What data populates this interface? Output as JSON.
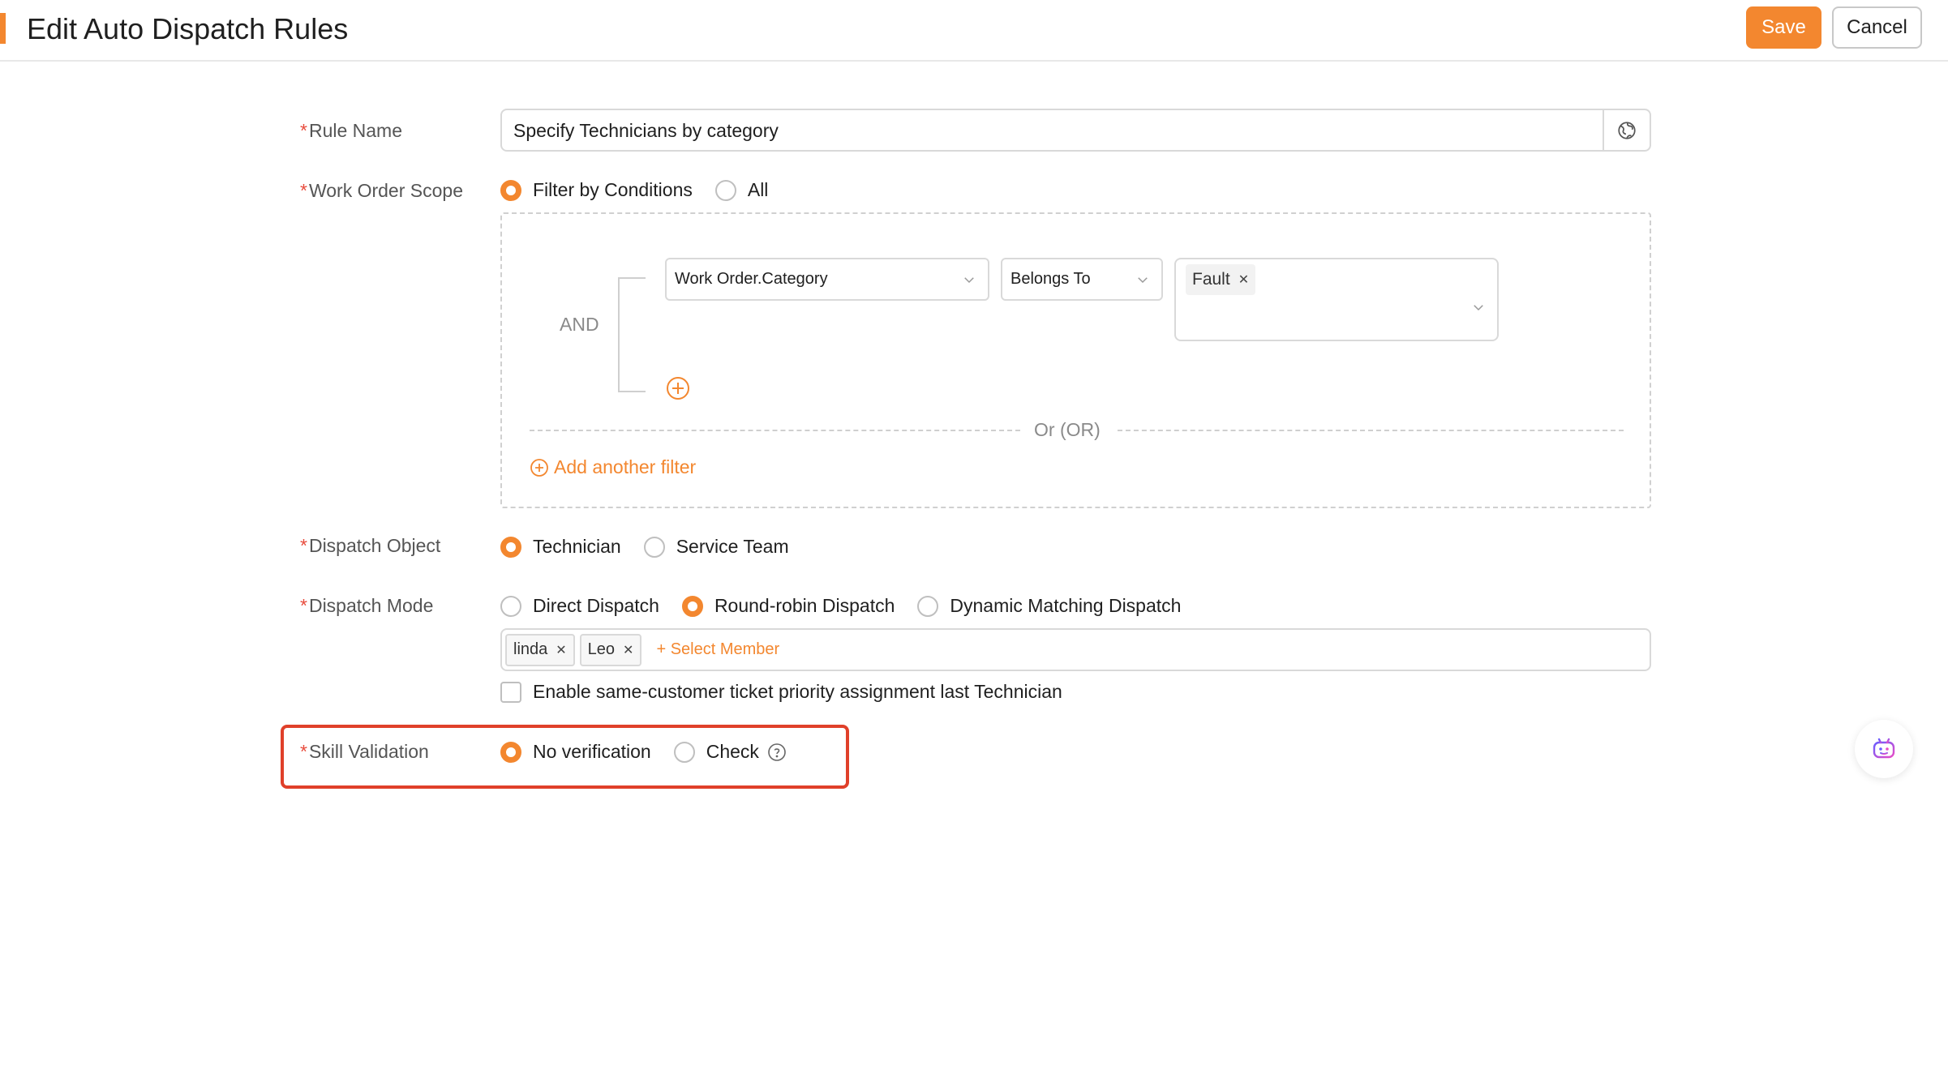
{
  "header": {
    "title": "Edit Auto Dispatch Rules",
    "save_label": "Save",
    "cancel_label": "Cancel"
  },
  "form": {
    "rule_name": {
      "label": "Rule Name",
      "value": "Specify Technicians by category",
      "suffix_icon": "globe-translate-icon"
    },
    "work_order_scope": {
      "label": "Work Order Scope",
      "options": [
        "Filter by Conditions",
        "All"
      ],
      "selected": "Filter by Conditions",
      "filter": {
        "logic": "AND",
        "condition": {
          "field": "Work Order.Category",
          "operator": "Belongs To",
          "values": [
            "Fault"
          ]
        },
        "or_divider": "Or (OR)",
        "add_filter_label": "Add another filter"
      }
    },
    "dispatch_object": {
      "label": "Dispatch Object",
      "options": [
        "Technician",
        "Service Team"
      ],
      "selected": "Technician"
    },
    "dispatch_mode": {
      "label": "Dispatch Mode",
      "options": [
        "Direct Dispatch",
        "Round-robin Dispatch",
        "Dynamic Matching Dispatch"
      ],
      "selected": "Round-robin Dispatch",
      "members": [
        "linda",
        "Leo"
      ],
      "select_member_label": "+ Select Member",
      "same_customer_checkbox": {
        "label": "Enable same-customer ticket priority assignment last Technician",
        "checked": false
      }
    },
    "skill_validation": {
      "label": "Skill Validation",
      "options": [
        "No verification",
        "Check"
      ],
      "selected": "No verification"
    }
  },
  "colors": {
    "accent": "#f3872f",
    "required": "#e84c3d",
    "highlight": "#e0402a"
  }
}
